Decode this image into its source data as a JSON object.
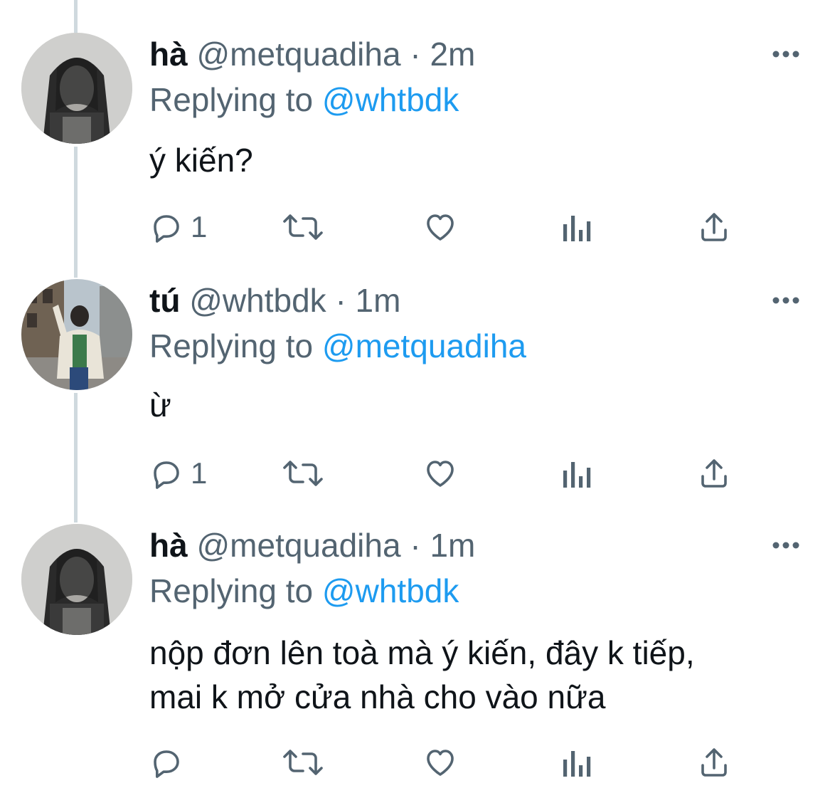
{
  "tweets": [
    {
      "name": "hà",
      "handle": "@metquadiha",
      "dot": "·",
      "time": "2m",
      "replying_prefix": "Replying to",
      "replying_to": "@whtbdk",
      "text_lines": [
        "ý kiến?"
      ],
      "reply_count": "1",
      "avatar": "portrait-veil-dark"
    },
    {
      "name": "tú",
      "handle": "@whtbdk",
      "dot": "·",
      "time": "1m",
      "replying_prefix": "Replying to",
      "replying_to": "@metquadiha",
      "text_lines": [
        "ừ"
      ],
      "reply_count": "1",
      "avatar": "street-photo"
    },
    {
      "name": "hà",
      "handle": "@metquadiha",
      "dot": "·",
      "time": "1m",
      "replying_prefix": "Replying to",
      "replying_to": "@whtbdk",
      "text_lines": [
        "nộp đơn lên toà mà ý kiến, đây k tiếp,",
        "mai k mở cửa nhà cho vào nữa"
      ],
      "reply_count": "",
      "avatar": "portrait-veil-dark"
    }
  ],
  "icons": {
    "reply": "reply-icon",
    "retweet": "retweet-icon",
    "like": "heart-icon",
    "analytics": "analytics-icon",
    "share": "share-icon",
    "more": "more-icon"
  },
  "colors": {
    "text": "#0f1419",
    "secondary": "#536471",
    "link": "#1d9bf0",
    "thread_line": "#cfd9de"
  }
}
